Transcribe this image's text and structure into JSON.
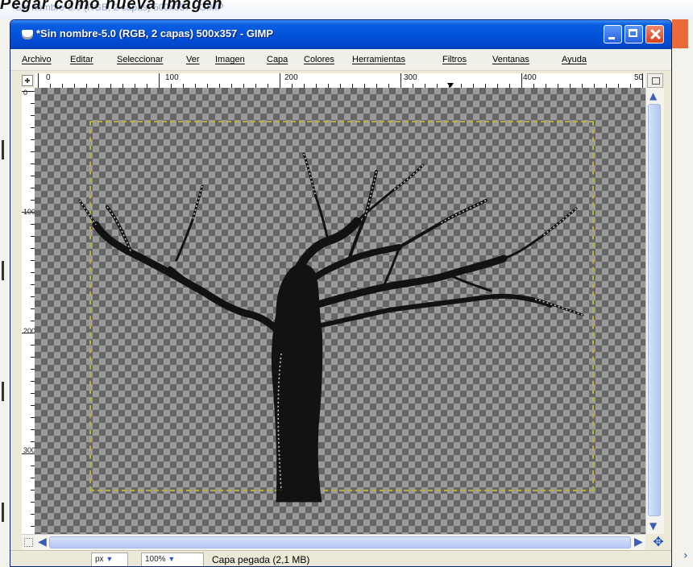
{
  "background": {
    "behind_window_text": "Pegar como nueva imagen",
    "behind_title_ghost": "*Sin nombre-5.0 (RGB, 2 capas) 500x357 - GIMP"
  },
  "window": {
    "title": "*Sin nombre-5.0 (RGB, 2 capas) 500x357 - GIMP",
    "buttons": {
      "minimize": "minimize",
      "maximize": "maximize",
      "close": "close"
    }
  },
  "menu": {
    "items": [
      "Archivo",
      "Editar",
      "Seleccionar",
      "Ver",
      "Imagen",
      "Capa",
      "Colores",
      "Herramientas",
      "Filtros",
      "Ventanas",
      "Ayuda"
    ]
  },
  "ruler": {
    "h_labels": [
      "0",
      "100",
      "200",
      "300",
      "400",
      "50"
    ],
    "v_labels": [
      "0",
      "100",
      "200",
      "300"
    ]
  },
  "canvas": {
    "content": "tree silhouette on transparent checkerboard",
    "colors": {
      "checker_light": "#9a9a9a",
      "checker_dark": "#666666",
      "layer_boundary": "#b8b040",
      "tree": "#121212"
    }
  },
  "statusbar": {
    "unit": "px",
    "zoom": "100%",
    "status": "Capa pegada (2,1 MB)"
  },
  "colors": {
    "titlebar": "#0050d8",
    "close_button": "#d4421b",
    "scrollbar": "#c4d4f6"
  }
}
